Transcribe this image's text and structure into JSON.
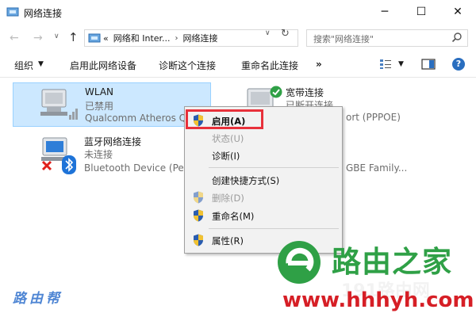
{
  "window": {
    "title": "网络连接",
    "minimize_glyph": "─",
    "maximize_glyph": "☐",
    "close_glyph": "✕"
  },
  "nav": {
    "back_glyph": "←",
    "forward_glyph": "→",
    "history_glyph": "∨",
    "up_glyph": "↑",
    "address_prefix": "«",
    "address_segments": [
      "网络和 Inter...",
      "网络连接"
    ],
    "address_sep": "›",
    "dropdown_glyph": "∨",
    "refresh_glyph": "↻",
    "search_placeholder": "搜索\"网络连接\""
  },
  "commandbar": {
    "organize": "组织",
    "organize_arrow": "▼",
    "enable": "启用此网络设备",
    "diagnose": "诊断这个连接",
    "rename": "重命名此连接",
    "more": "»",
    "view_dropdown": "▼",
    "help": "?"
  },
  "items": {
    "wlan": {
      "name": "WLAN",
      "status": "已禁用",
      "device": "Qualcomm Atheros Q"
    },
    "broadband": {
      "name": "宽带连接",
      "status": "已断开连接",
      "device": "ort (PPPOE)"
    },
    "bluetooth": {
      "name": "蓝牙网络连接",
      "status": "未连接",
      "device": "Bluetooth Device (Per"
    },
    "ethernet": {
      "device": "GBE Family..."
    }
  },
  "context_menu": {
    "enable": "启用(A)",
    "status": "状态(U)",
    "diagnose": "诊断(I)",
    "shortcut": "创建快捷方式(S)",
    "delete": "删除(D)",
    "rename": "重命名(M)",
    "properties": "属性(R)"
  },
  "watermarks": {
    "left": "路由帮",
    "brand": "路由之家",
    "url_bg": "191路由网",
    "url": "www.hhhyh.com"
  },
  "colors": {
    "selection_bg": "#cce8ff",
    "highlight_box": "#e8313b",
    "brand_green": "#2fa046",
    "brand_red": "#d61f26",
    "shield_blue": "#2a5db0",
    "shield_yellow": "#f1c232"
  }
}
